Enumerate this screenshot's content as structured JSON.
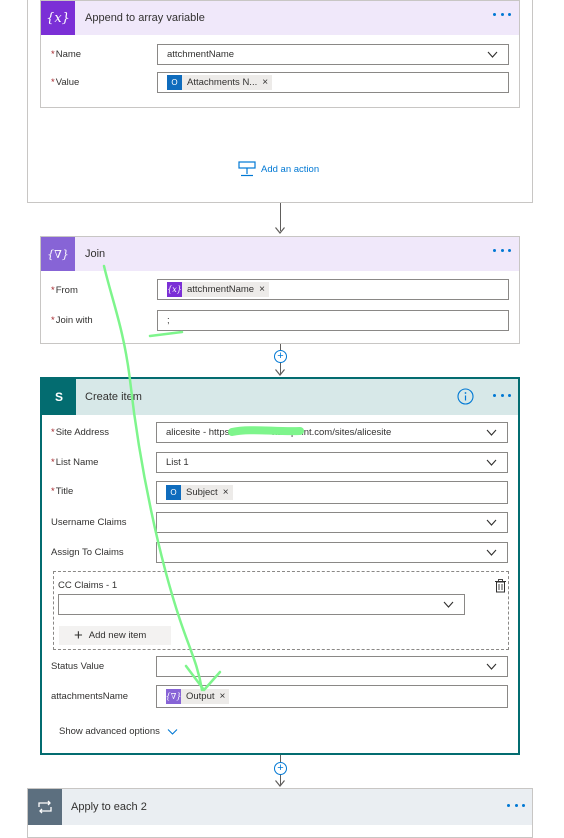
{
  "append_card": {
    "title": "Append to array variable",
    "name_label": "Name",
    "name_value": "attchmentName",
    "value_label": "Value",
    "value_token": "Attachments N...",
    "add_action": "Add an action"
  },
  "join_card": {
    "title": "Join",
    "from_label": "From",
    "from_token": "attchmentName",
    "joinwith_label": "Join with",
    "joinwith_value": ";"
  },
  "create_card": {
    "title": "Create item",
    "site_label": "Site Address",
    "site_value_a": "alicesite - https:",
    "site_value_b": "harepoint.com/sites/alicesite",
    "list_label": "List Name",
    "list_value": "List 1",
    "title_label": "Title",
    "title_token": "Subject",
    "username_label": "Username Claims",
    "assign_label": "Assign To Claims",
    "cc_label": "CC Claims - 1",
    "add_new_item": "Add new item",
    "status_label": "Status Value",
    "attach_label": "attachmentsName",
    "attach_token": "Output",
    "advanced": "Show advanced options"
  },
  "apply_card": {
    "title": "Apply to each 2"
  },
  "icons": {
    "variable": "{x}",
    "join": "{∇}",
    "sharepoint": "S"
  },
  "colors": {
    "variable_header": "#f0e8fa",
    "variable_icon": "#7b2fd6",
    "join_icon": "#8764d6",
    "sharepoint_header": "#d7e8e8",
    "sharepoint_icon": "#036c70",
    "selected_border": "#036c70",
    "accent": "#0078d4",
    "annotation": "#7ef58c"
  }
}
